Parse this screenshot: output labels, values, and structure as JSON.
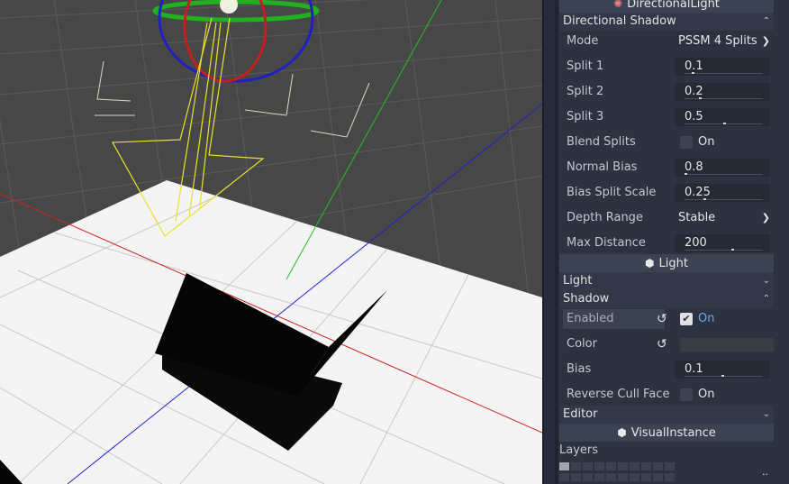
{
  "inspector": {
    "directional_light_header": "DirectionalLight",
    "directional_shadow_section": "Directional Shadow",
    "mode": {
      "label": "Mode",
      "value": "PSSM 4 Splits"
    },
    "split1": {
      "label": "Split 1",
      "value": "0.1"
    },
    "split2": {
      "label": "Split 2",
      "value": "0.2"
    },
    "split3": {
      "label": "Split 3",
      "value": "0.5"
    },
    "blend_splits": {
      "label": "Blend Splits",
      "value": "On",
      "checked": false
    },
    "normal_bias": {
      "label": "Normal Bias",
      "value": "0.8"
    },
    "bias_split_scale": {
      "label": "Bias Split Scale",
      "value": "0.25"
    },
    "depth_range": {
      "label": "Depth Range",
      "value": "Stable"
    },
    "max_distance": {
      "label": "Max Distance",
      "value": "200"
    },
    "light_header": "Light",
    "light_section": "Light",
    "shadow_section": "Shadow",
    "enabled": {
      "label": "Enabled",
      "value": "On",
      "checked": true
    },
    "color": {
      "label": "Color",
      "swatch": "#3a3d44"
    },
    "bias": {
      "label": "Bias",
      "value": "0.1"
    },
    "reverse_cull_face": {
      "label": "Reverse Cull Face",
      "value": "On",
      "checked": false
    },
    "editor_section": "Editor",
    "visual_instance_header": "VisualInstance",
    "layers_label": "Layers",
    "layers_more": ".."
  },
  "colors": {
    "accent": "#69a8f0",
    "panel_bg": "#2c3240",
    "viewport_bg": "#474747"
  }
}
